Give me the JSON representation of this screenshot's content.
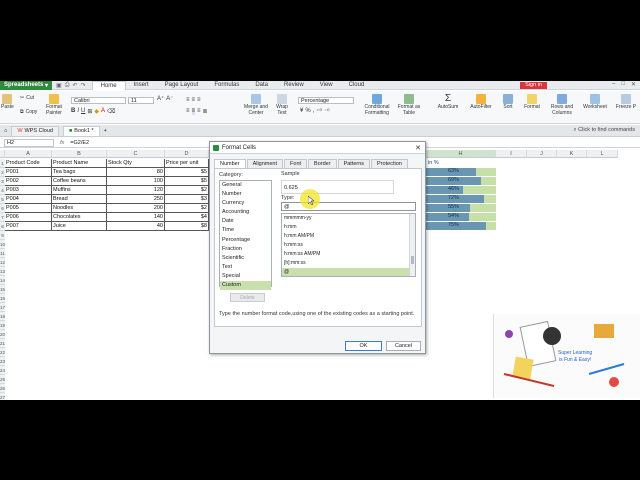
{
  "app": {
    "name": "Spreadsheets",
    "menus": [
      "Home",
      "Insert",
      "Page Layout",
      "Formulas",
      "Data",
      "Review",
      "View",
      "Cloud"
    ],
    "active_menu": "Home",
    "signin": "Sign in"
  },
  "ribbon": {
    "paste": "Paste",
    "cut": "Cut",
    "copy": "Copy",
    "format_painter": "Format Painter",
    "font_name": "Calibri",
    "font_size": "11",
    "merge_center": "Merge and Center",
    "wrap_text": "Wrap Text",
    "number_format": "Percentage",
    "conditional_formatting": "Conditional Formatting",
    "format_as_table": "Format as Table",
    "autosum": "AutoSum",
    "autofilter": "AutoFilter",
    "sort": "Sort",
    "format": "Format",
    "rows_columns": "Rows and Columns",
    "worksheet": "Worksheet",
    "freeze": "Freeze P"
  },
  "tabs": {
    "wps_cloud": "WPS Cloud",
    "book": "Book1 *",
    "find": "Click to find commands"
  },
  "formula_bar": {
    "cell_ref": "H2",
    "fx": "fx",
    "formula": "=G2/E2"
  },
  "grid": {
    "columns": [
      "A",
      "B",
      "C",
      "D",
      "H",
      "I",
      "J",
      "K",
      "L"
    ],
    "rows": [
      "1",
      "2",
      "3",
      "4",
      "5",
      "6",
      "7",
      "8",
      "9",
      "10",
      "11",
      "12",
      "13",
      "14",
      "15",
      "16",
      "17",
      "18",
      "19",
      "20",
      "21",
      "22",
      "23",
      "24",
      "25",
      "26",
      "27"
    ],
    "headers": [
      "Product Code",
      "Product Name",
      "Stock Qty",
      "Price per unit",
      "in %"
    ],
    "data": [
      [
        "P001",
        "Tea bags",
        "80",
        "$5"
      ],
      [
        "P002",
        "Coffee beans",
        "100",
        "$5"
      ],
      [
        "P003",
        "Muffins",
        "120",
        "$2"
      ],
      [
        "P004",
        "Bread",
        "250",
        "$3"
      ],
      [
        "P005",
        "Noodles",
        "200",
        "$2"
      ],
      [
        "P006",
        "Chocolates",
        "140",
        "$4"
      ],
      [
        "P007",
        "Juice",
        "40",
        "$8"
      ]
    ],
    "percent_labels": [
      "63%",
      "69%",
      "46%",
      "72%",
      "55%",
      "54%",
      "75%"
    ],
    "percent_values": [
      0.63,
      0.69,
      0.46,
      0.72,
      0.55,
      0.54,
      0.75
    ],
    "bar_color": "#4a7fb5"
  },
  "dialog": {
    "title": "Format Cells",
    "tabs": [
      "Number",
      "Alignment",
      "Font",
      "Border",
      "Patterns",
      "Protection"
    ],
    "category_label": "Category:",
    "categories": [
      "General",
      "Number",
      "Currency",
      "Accounting",
      "Date",
      "Time",
      "Percentage",
      "Fraction",
      "Scientific",
      "Text",
      "Special",
      "Custom"
    ],
    "selected_category": "Custom",
    "sample_label": "Sample",
    "sample_value": "0.625",
    "type_label": "Type:",
    "type_value": "@",
    "type_list": [
      "mmmmm-yy",
      "h:mm",
      "h:mm AM/PM",
      "h:mm:ss",
      "h:mm:ss AM/PM",
      "[h]:mm:ss",
      "@"
    ],
    "delete": "Delete",
    "hint": "Type the number format code,using one of the existing codes as a starting point.",
    "ok": "OK",
    "cancel": "Cancel"
  },
  "promo": {
    "line1": "Super Learning",
    "line2": "is Fun & Easy!"
  }
}
